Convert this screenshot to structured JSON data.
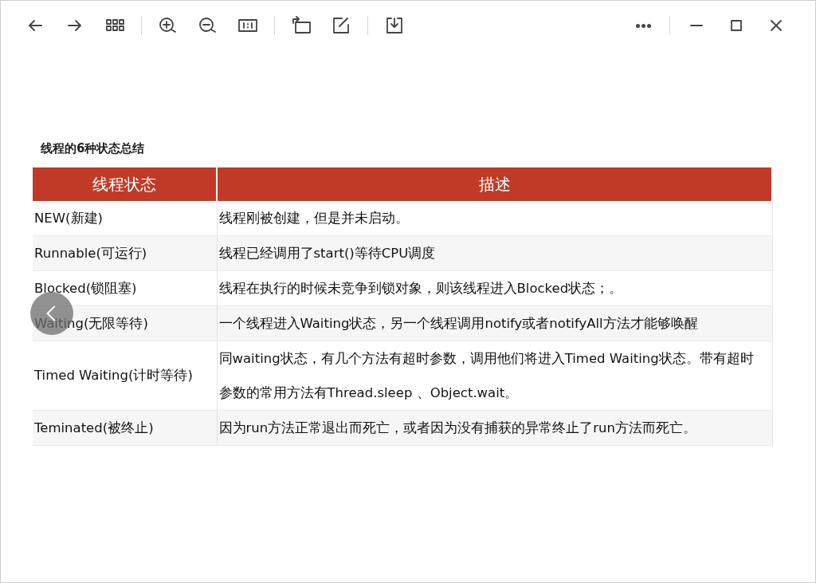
{
  "toolbar": {
    "left": [
      {
        "kind": "back"
      },
      {
        "kind": "forward"
      },
      {
        "kind": "grid"
      },
      {
        "kind": "sep"
      },
      {
        "kind": "zoom-in"
      },
      {
        "kind": "zoom-out"
      },
      {
        "kind": "actual-size"
      },
      {
        "kind": "sep"
      },
      {
        "kind": "rotate"
      },
      {
        "kind": "edit"
      },
      {
        "kind": "sep"
      },
      {
        "kind": "download"
      }
    ],
    "right": [
      {
        "kind": "more"
      },
      {
        "kind": "sep"
      },
      {
        "kind": "minimize"
      },
      {
        "kind": "maximize"
      },
      {
        "kind": "close"
      }
    ]
  },
  "slide": {
    "title": "线程的6种状态总结",
    "table": {
      "columns": [
        "线程状态",
        "描述"
      ],
      "rows": [
        {
          "cells": [
            "NEW(新建)",
            "线程刚被创建，但是并未启动。"
          ]
        },
        {
          "cells": [
            "Runnable(可运行)",
            "线程已经调用了start()等待CPU调度"
          ]
        },
        {
          "cells": [
            "Blocked(锁阻塞)",
            "线程在执行的时候未竞争到锁对象，则该线程进入Blocked状态；。"
          ]
        },
        {
          "cells": [
            "Waiting(无限等待)",
            "一个线程进入Waiting状态，另一个线程调用notify或者notifyAll方法才能够唤醒"
          ]
        },
        {
          "cells": [
            "Timed Waiting(计时等待)",
            "同waiting状态，有几个方法有超时参数，调用他们将进入Timed Waiting状态。带有超时参数的常用方法有Thread.sleep 、Object.wait。"
          ]
        },
        {
          "cells": [
            "Teminated(被终止)",
            "因为run方法正常退出而死亡，或者因为没有捕获的异常终止了run方法而死亡。"
          ]
        }
      ]
    }
  },
  "prev_button": {
    "kind": "prev"
  }
}
